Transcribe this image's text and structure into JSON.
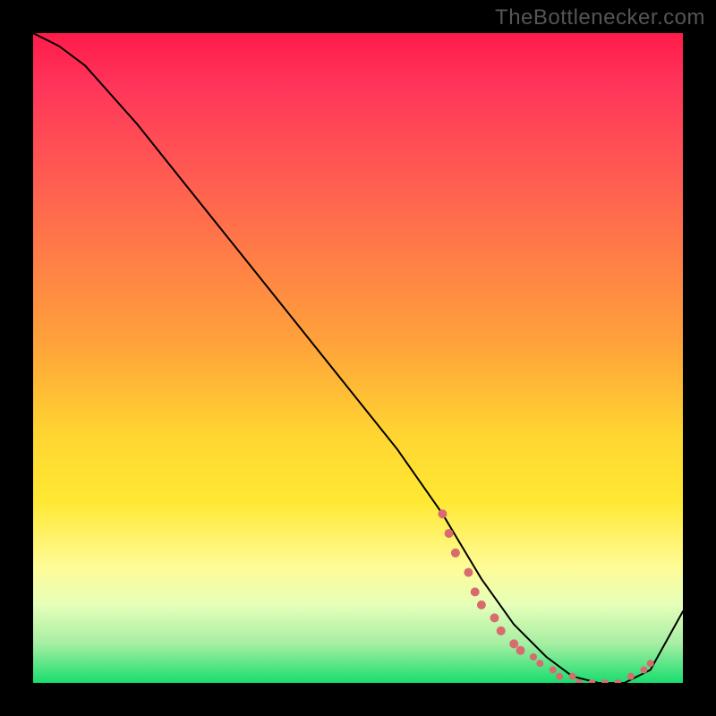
{
  "watermark": "TheBottlenecker.com",
  "chart_data": {
    "type": "line",
    "title": "",
    "xlabel": "",
    "ylabel": "",
    "xlim": [
      0,
      100
    ],
    "ylim": [
      0,
      100
    ],
    "background": "thermal-gradient",
    "series": [
      {
        "name": "bottleneck-curve",
        "x": [
          0,
          4,
          8,
          16,
          24,
          32,
          40,
          48,
          56,
          63,
          69,
          74,
          79,
          83,
          87,
          91,
          95,
          100
        ],
        "y": [
          100,
          98,
          95,
          86,
          76,
          66,
          56,
          46,
          36,
          26,
          16,
          9,
          4,
          1,
          0,
          0,
          2,
          11
        ]
      }
    ],
    "markers": {
      "name": "highlight-dots",
      "color": "#d76b6e",
      "points_x": [
        63,
        64,
        65,
        67,
        68,
        69,
        71,
        72,
        74,
        75,
        77,
        78,
        80,
        81,
        83,
        84,
        86,
        88,
        90,
        92,
        94,
        95
      ],
      "points_y": [
        26,
        23,
        20,
        17,
        14,
        12,
        10,
        8,
        6,
        5,
        4,
        3,
        2,
        1,
        1,
        0,
        0,
        0,
        0,
        1,
        2,
        3
      ]
    }
  }
}
